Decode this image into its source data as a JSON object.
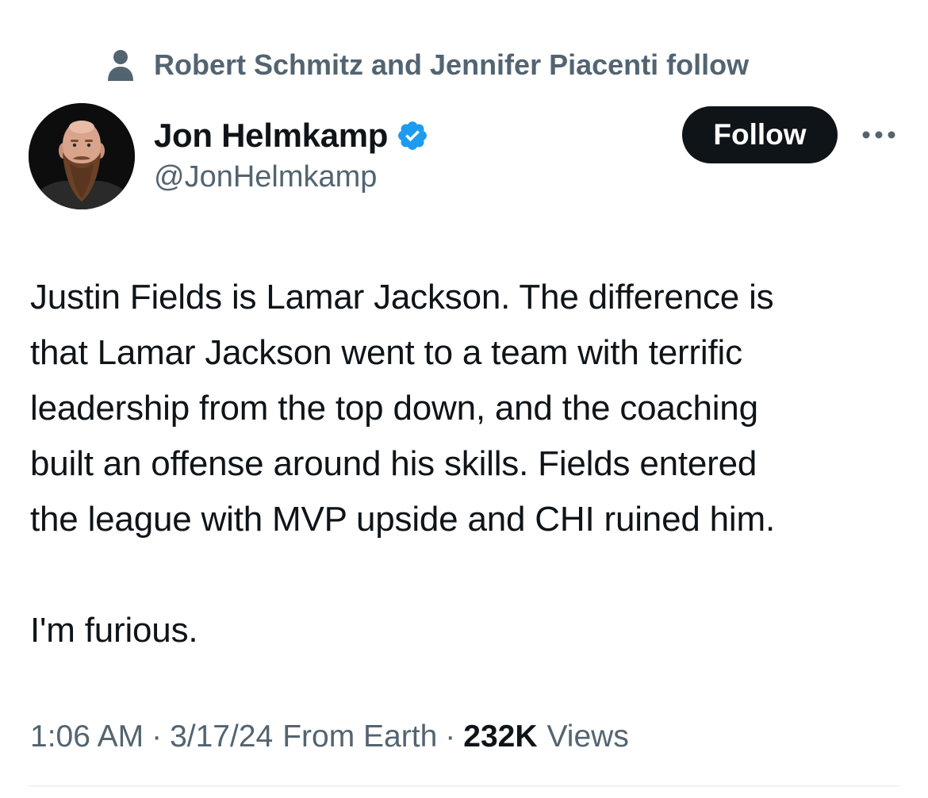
{
  "social_context": {
    "text": "Robert Schmitz and Jennifer Piacenti follow",
    "icon": "person-icon"
  },
  "author": {
    "display_name": "Jon Helmkamp",
    "handle": "@JonHelmkamp",
    "verified": true,
    "verified_color": "#1d9bf0"
  },
  "actions": {
    "follow_label": "Follow",
    "more_icon": "more-horizontal-icon"
  },
  "tweet": {
    "lines": [
      "Justin Fields is Lamar Jackson. The difference is",
      "that Lamar Jackson went to a team with terrific",
      "leadership from the top down, and the coaching",
      "built an offense around his skills. Fields entered",
      "the league with MVP upside and CHI ruined him."
    ],
    "closing": "I'm furious."
  },
  "meta": {
    "time": "1:06 AM",
    "separator": "·",
    "date": "3/17/24",
    "source": "From Earth",
    "views_count": "232K",
    "views_label": "Views"
  },
  "colors": {
    "text_primary": "#0f1419",
    "text_secondary": "#536471",
    "button_bg": "#0f1419",
    "divider": "#eff3f4"
  }
}
